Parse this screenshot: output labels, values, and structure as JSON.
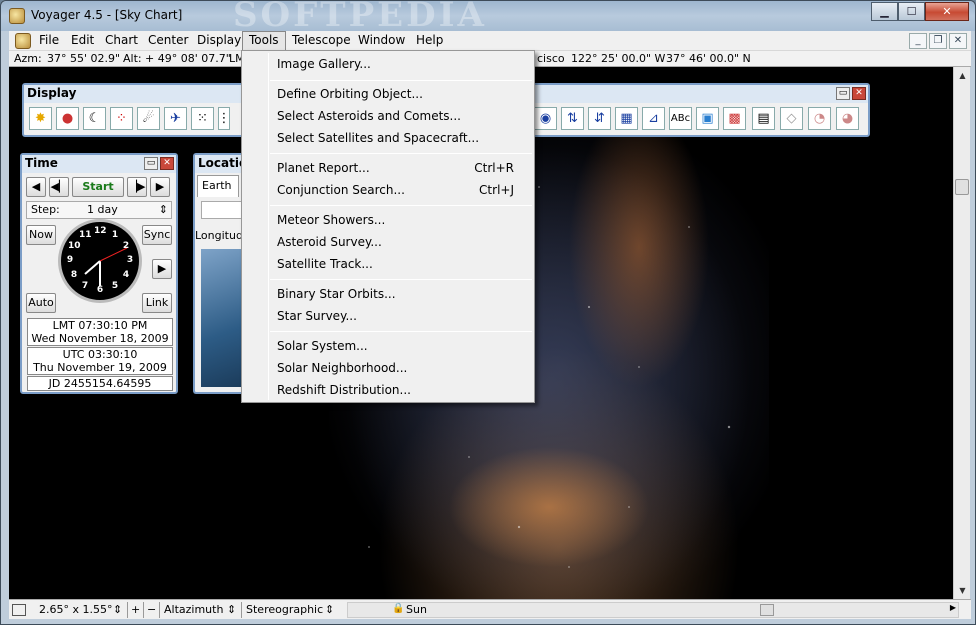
{
  "window": {
    "title": "Voyager 4.5 - [Sky Chart]",
    "watermark": "SOFTPEDIA"
  },
  "menubar": {
    "items": [
      "File",
      "Edit",
      "Chart",
      "Center",
      "Display",
      "Tools",
      "Telescope",
      "Window",
      "Help"
    ],
    "active": "Tools"
  },
  "coords": {
    "azm_label": "Azm:",
    "azm": "37° 55' 02.9\"",
    "alt_label": "Alt:",
    "alt": "+ 49° 08' 07.7\"",
    "lm_label": "LM",
    "place": "cisco",
    "longitude": "122° 25' 00.0\" W",
    "latitude": "37° 46' 00.0\" N"
  },
  "display_panel": {
    "title": "Display"
  },
  "time_panel": {
    "title": "Time",
    "start": "Start",
    "step_label": "Step:",
    "step_value": "1 day",
    "now": "Now",
    "sync": "Sync",
    "auto": "Auto",
    "link": "Link",
    "lmt_time": "LMT 07:30:10 PM",
    "lmt_date": "Wed November 18, 2009",
    "utc_time": "UTC 03:30:10",
    "utc_date": "Thu November 19, 2009",
    "jd": "JD 2455154.64595"
  },
  "location_panel": {
    "title": "Locatio",
    "tab": "Earth",
    "longitude_label": "Longitud"
  },
  "tools_menu": {
    "groups": [
      [
        {
          "label": "Image Gallery..."
        }
      ],
      [
        {
          "label": "Define Orbiting Object..."
        },
        {
          "label": "Select Asteroids and Comets..."
        },
        {
          "label": "Select Satellites and Spacecraft..."
        }
      ],
      [
        {
          "label": "Planet Report...",
          "shortcut": "Ctrl+R"
        },
        {
          "label": "Conjunction Search...",
          "shortcut": "Ctrl+J"
        }
      ],
      [
        {
          "label": "Meteor Showers..."
        },
        {
          "label": "Asteroid Survey..."
        },
        {
          "label": "Satellite Track..."
        }
      ],
      [
        {
          "label": "Binary Star Orbits..."
        },
        {
          "label": "Star Survey..."
        }
      ],
      [
        {
          "label": "Solar System..."
        },
        {
          "label": "Solar Neighborhood..."
        },
        {
          "label": "Redshift Distribution..."
        }
      ]
    ]
  },
  "statusbar": {
    "fov": "2.65° x 1.55°",
    "plus": "+",
    "minus": "−",
    "coord_system": "Altazimuth",
    "projection": "Stereographic",
    "center": "Sun"
  },
  "clock_numbers": [
    "12",
    "1",
    "2",
    "3",
    "4",
    "5",
    "6",
    "7",
    "8",
    "9",
    "10",
    "11"
  ]
}
